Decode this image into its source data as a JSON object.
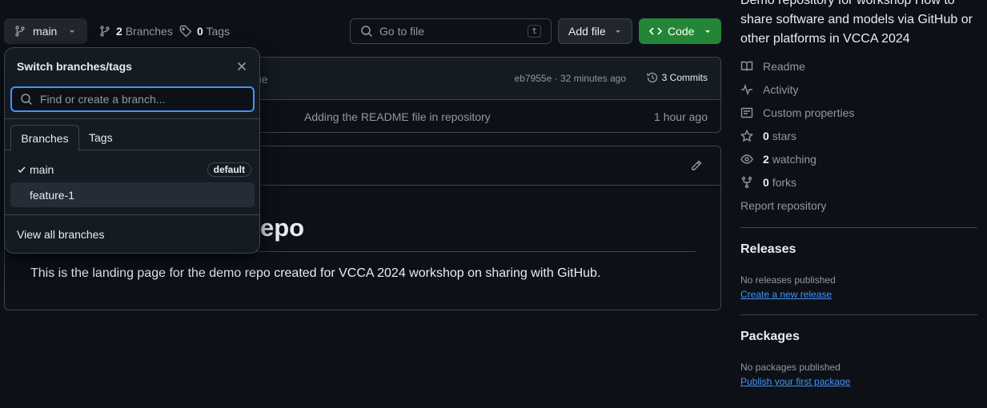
{
  "toolbar": {
    "branch_label": "main",
    "branches_count": "2",
    "branches_label": "Branches",
    "tags_count": "0",
    "tags_label": "Tags",
    "goto_placeholder": "Go to file",
    "goto_shortcut": "t",
    "add_file_label": "Add file",
    "code_label": "Code"
  },
  "commit": {
    "message_fragment": "ue",
    "hash_time": "eb7955e · 32 minutes ago",
    "commits_label": "3 Commits",
    "readme_message": "Adding the README file in repository",
    "readme_time": "1 hour ago"
  },
  "readme": {
    "heading_fragment": "epo",
    "paragraph": "This is the landing page for the demo repo created for VCCA 2024 workshop on sharing with GitHub."
  },
  "dropdown": {
    "title": "Switch branches/tags",
    "search_placeholder": "Find or create a branch...",
    "tabs": [
      "Branches",
      "Tags"
    ],
    "branches": [
      {
        "name": "main",
        "badge": "default",
        "selected": true
      },
      {
        "name": "feature-1",
        "badge": "",
        "selected": false
      }
    ],
    "view_all": "View all branches"
  },
  "sidebar": {
    "about_text": "Demo repository for workshop How to share software and models via GitHub or other platforms in VCCA 2024",
    "items": [
      {
        "icon": "book-icon",
        "label": "Readme"
      },
      {
        "icon": "pulse-icon",
        "label": "Activity"
      },
      {
        "icon": "note-icon",
        "label": "Custom properties"
      },
      {
        "icon": "star-icon",
        "count": "0",
        "label": "stars"
      },
      {
        "icon": "eye-icon",
        "count": "2",
        "label": "watching"
      },
      {
        "icon": "fork-icon",
        "count": "0",
        "label": "forks"
      }
    ],
    "report_label": "Report repository",
    "releases": {
      "title": "Releases",
      "empty": "No releases published",
      "link": "Create a new release"
    },
    "packages": {
      "title": "Packages",
      "empty": "No packages published",
      "link": "Publish your first package"
    }
  },
  "colors": {
    "accent": "#4493f8",
    "green_button": "#238636",
    "background": "#0d1117"
  }
}
